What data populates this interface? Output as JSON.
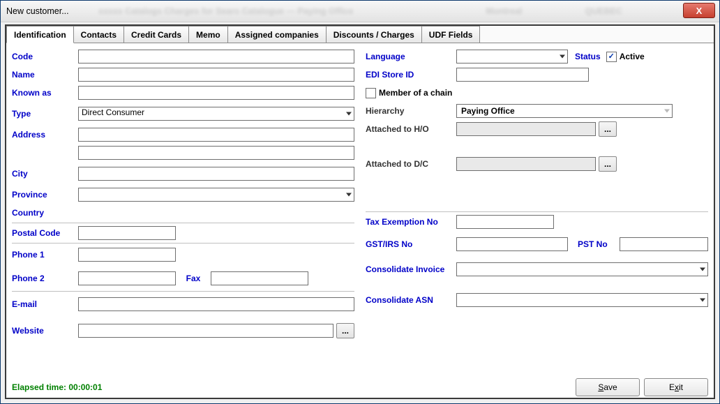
{
  "window": {
    "title": "New customer...",
    "close_glyph": "X"
  },
  "tabs": [
    "Identification",
    "Contacts",
    "Credit Cards",
    "Memo",
    "Assigned companies",
    "Discounts / Charges",
    "UDF Fields"
  ],
  "selected_tab": 0,
  "left": {
    "code": "Code",
    "name": "Name",
    "known_as": "Known as",
    "type": "Type",
    "type_value": "Direct Consumer",
    "address": "Address",
    "city": "City",
    "province": "Province",
    "country": "Country",
    "postal_code": "Postal Code",
    "phone1": "Phone 1",
    "phone2": "Phone 2",
    "fax": "Fax",
    "email": "E-mail",
    "website": "Website",
    "browse": "..."
  },
  "right": {
    "language": "Language",
    "status": "Status",
    "active": "Active",
    "edi": "EDI Store ID",
    "member": "Member of a chain",
    "hierarchy": "Hierarchy",
    "hierarchy_value": "Paying Office",
    "ho": "Attached to H/O",
    "dc": "Attached to D/C",
    "browse": "...",
    "tax": "Tax Exemption No",
    "gst": "GST/IRS No",
    "pst": "PST No",
    "ci": "Consolidate Invoice",
    "ca": "Consolidate ASN"
  },
  "footer": {
    "elapsed_label": "Elapsed time: ",
    "elapsed_value": "00:00:01",
    "save": "Save",
    "exit": "Exit"
  }
}
